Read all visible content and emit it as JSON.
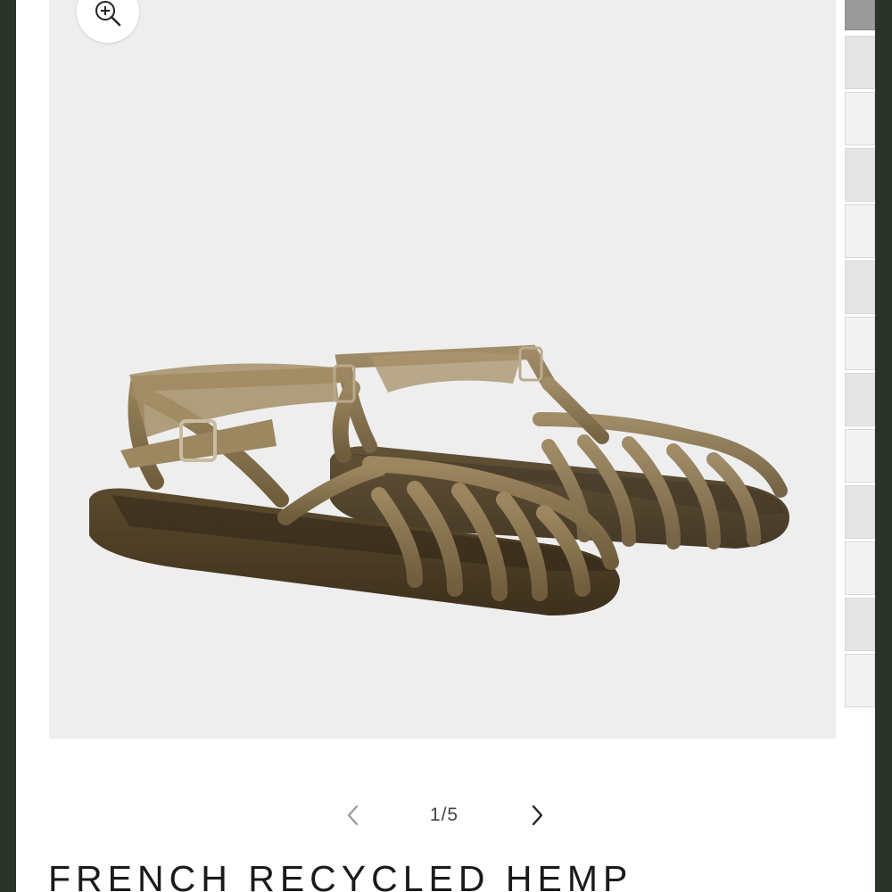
{
  "gallery": {
    "zoom_icon": "zoom-in-icon",
    "main_image_alt": "Sandals",
    "thumbnails_count": 13,
    "active_thumbnail": 1
  },
  "pager": {
    "prev_icon": "chevron-left-icon",
    "next_icon": "chevron-right-icon",
    "counter": "1/5"
  },
  "product": {
    "title": "FRENCH RECYCLED HEMP"
  },
  "colors": {
    "frame_background": "#2b342a",
    "image_background": "#eeeeef",
    "sandal_jelly": "#8a7650",
    "sole": "#4a3a22"
  }
}
